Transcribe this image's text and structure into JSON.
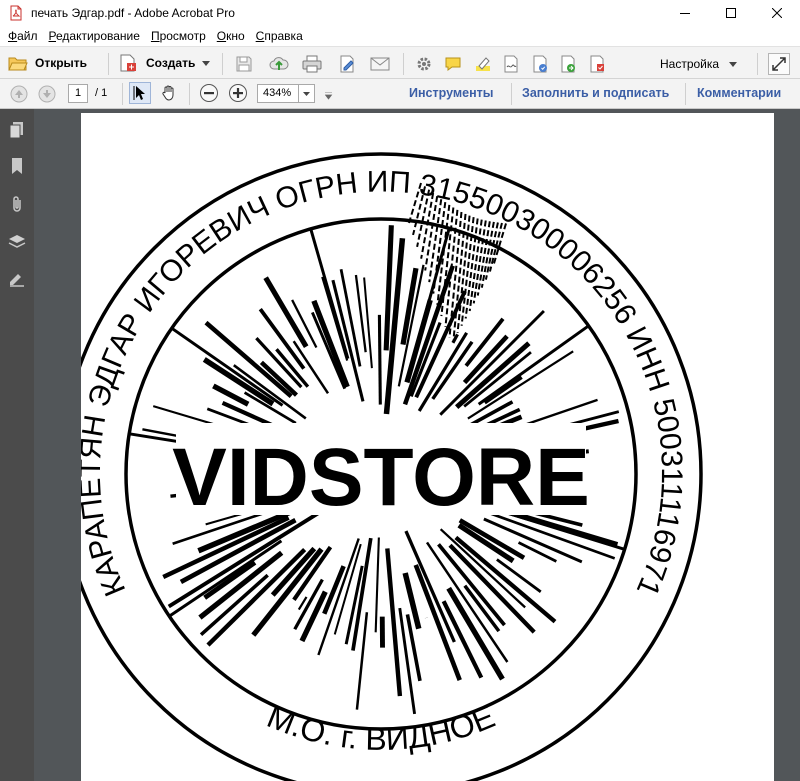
{
  "window": {
    "title": "печать Эдгар.pdf - Adobe Acrobat Pro"
  },
  "menu": [
    {
      "label": "Файл",
      "accel": "Ф",
      "rest": "айл"
    },
    {
      "label": "Редактирование",
      "accel": "Р",
      "rest": "едактирование"
    },
    {
      "label": "Просмотр",
      "accel": "П",
      "rest": "росмотр"
    },
    {
      "label": "Окно",
      "accel": "О",
      "rest": "кно"
    },
    {
      "label": "Справка",
      "accel": "С",
      "rest": "правка"
    }
  ],
  "toolbar": {
    "open_label": "Открыть",
    "create_label": "Создать",
    "customize_label": "Настройка"
  },
  "navigation": {
    "current_page": "1",
    "page_total": "/ 1",
    "zoom": "434%"
  },
  "panels": {
    "tools": "Инструменты",
    "fill_sign": "Заполнить и подписать",
    "comments": "Комментарии"
  },
  "stamp": {
    "outer_text": "КАРАПЕТЯН ЭДГАР ИГОРЕВИЧ ОГРН ИП 315500300006256 ИНН 500311116971",
    "bottom_text": "М.О. г. ВИДНОЕ",
    "center_text": "VIDSTORE"
  },
  "colors": {
    "panel_link": "#3b5ea6",
    "sidebar": "#4b4b4b",
    "canvas": "#525659"
  }
}
